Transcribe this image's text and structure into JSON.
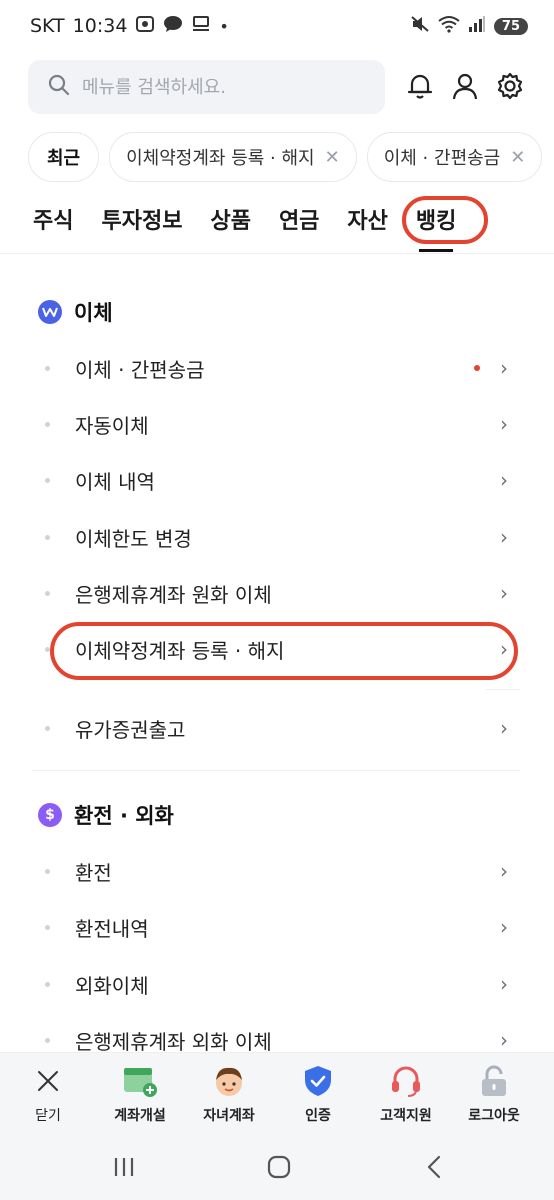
{
  "status": {
    "carrier": "SKT",
    "time": "10:34",
    "battery": "75"
  },
  "search": {
    "placeholder": "메뉴를 검색하세요."
  },
  "recent": {
    "label": "최근",
    "chips": [
      "이체약정계좌 등록 · 해지",
      "이체 · 간편송금"
    ]
  },
  "tabs": [
    "주식",
    "투자정보",
    "상품",
    "연금",
    "자산",
    "뱅킹"
  ],
  "sections": [
    {
      "title": "이체",
      "icon": "W",
      "items": [
        "이체 · 간편송금",
        "자동이체",
        "이체 내역",
        "이체한도 변경",
        "은행제휴계좌 원화 이체",
        "이체약정계좌 등록 · 해지",
        "유가증권출고"
      ]
    },
    {
      "title": "환전 · 외화",
      "icon": "$",
      "items": [
        "환전",
        "환전내역",
        "외화이체",
        "은행제휴계좌 외화 이체"
      ]
    }
  ],
  "bottom": {
    "close": "닫기",
    "items": [
      "계좌개설",
      "자녀계좌",
      "인증",
      "고객지원",
      "로그아웃"
    ]
  },
  "colors": {
    "highlight": "#e2442f",
    "transfer_icon": "#4a63e6",
    "fx_icon": "#8b5cf6"
  }
}
